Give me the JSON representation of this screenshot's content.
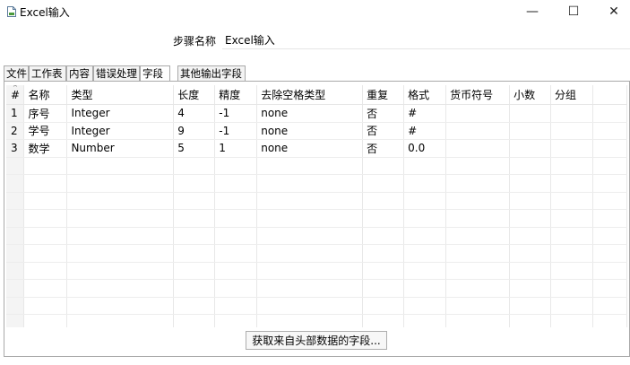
{
  "window": {
    "title": "Excel输入",
    "controls": {
      "minimize": "—",
      "maximize": "☐",
      "close": "✕"
    }
  },
  "step_name": {
    "label": "步骤名称",
    "value": "Excel输入"
  },
  "tabs": [
    {
      "label": "文件"
    },
    {
      "label": "工作表"
    },
    {
      "label": "内容"
    },
    {
      "label": "错误处理"
    },
    {
      "label": "字段",
      "active": true
    },
    {
      "label": "其他输出字段"
    }
  ],
  "fields_table": {
    "columns": [
      "#",
      "名称",
      "类型",
      "长度",
      "精度",
      "去除空格类型",
      "重复",
      "格式",
      "货币符号",
      "小数",
      "分组"
    ],
    "rows": [
      [
        "1",
        "序号",
        "Integer",
        "4",
        "-1",
        "none",
        "否",
        "#",
        "",
        "",
        ""
      ],
      [
        "2",
        "学号",
        "Integer",
        "9",
        "-1",
        "none",
        "否",
        "#",
        "",
        "",
        ""
      ],
      [
        "3",
        "数学",
        "Number",
        "5",
        "1",
        "none",
        "否",
        "0.0",
        "",
        "",
        ""
      ]
    ]
  },
  "buttons": {
    "fetch_fields": "获取来自头部数据的字段..."
  }
}
